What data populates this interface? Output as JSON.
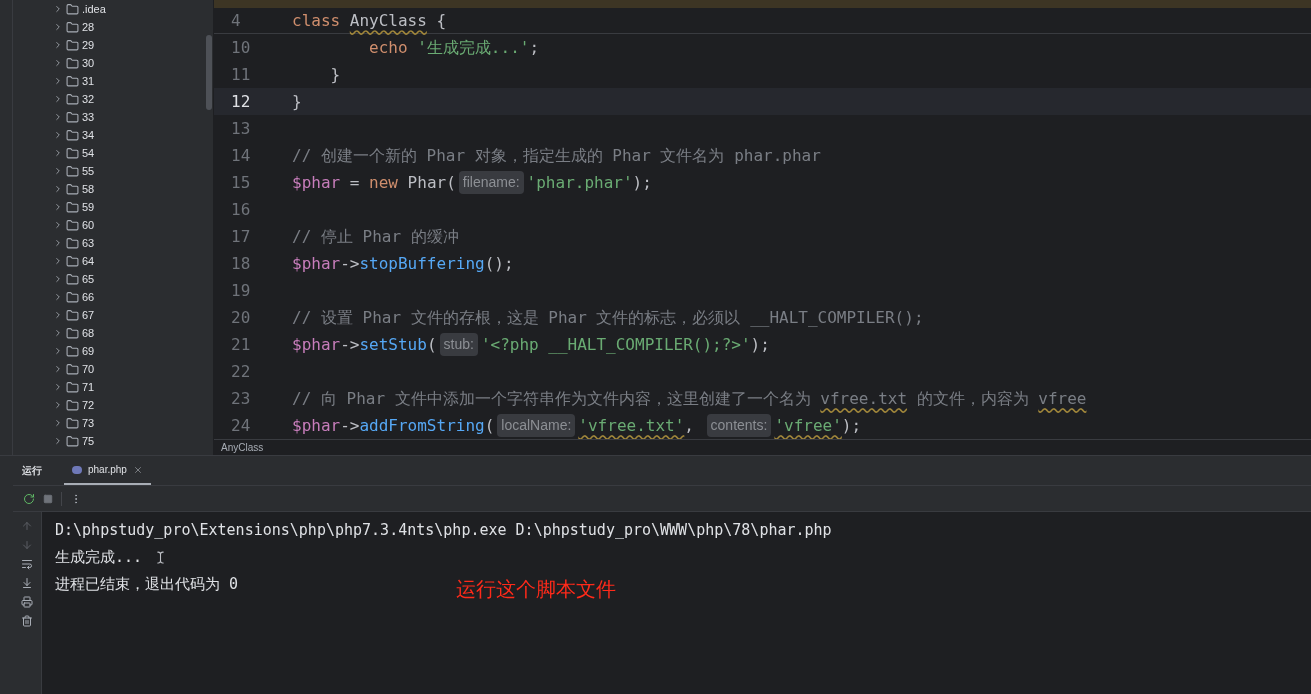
{
  "project_tree": {
    "items": [
      {
        "label": ".idea",
        "expanded": false
      },
      {
        "label": "28",
        "expanded": false
      },
      {
        "label": "29",
        "expanded": false
      },
      {
        "label": "30",
        "expanded": false
      },
      {
        "label": "31",
        "expanded": false
      },
      {
        "label": "32",
        "expanded": false
      },
      {
        "label": "33",
        "expanded": false
      },
      {
        "label": "34",
        "expanded": false
      },
      {
        "label": "54",
        "expanded": false
      },
      {
        "label": "55",
        "expanded": false
      },
      {
        "label": "58",
        "expanded": false
      },
      {
        "label": "59",
        "expanded": false
      },
      {
        "label": "60",
        "expanded": false
      },
      {
        "label": "63",
        "expanded": false
      },
      {
        "label": "64",
        "expanded": false
      },
      {
        "label": "65",
        "expanded": false
      },
      {
        "label": "66",
        "expanded": false
      },
      {
        "label": "67",
        "expanded": false
      },
      {
        "label": "68",
        "expanded": false
      },
      {
        "label": "69",
        "expanded": false
      },
      {
        "label": "70",
        "expanded": false
      },
      {
        "label": "71",
        "expanded": false
      },
      {
        "label": "72",
        "expanded": false
      },
      {
        "label": "73",
        "expanded": false
      },
      {
        "label": "75",
        "expanded": false
      }
    ]
  },
  "editor": {
    "sticky_line": {
      "number": "4",
      "tokens": [
        {
          "kind": "kw",
          "text": "class "
        },
        {
          "kind": "plain",
          "text": "AnyClass",
          "warn": true
        },
        {
          "kind": "plain",
          "text": " {"
        }
      ]
    },
    "lines": [
      {
        "number": "10",
        "current": false,
        "tokens": [
          {
            "kind": "kw",
            "text": "        echo"
          },
          {
            "kind": "str",
            "text": " '生成完成...'"
          },
          {
            "kind": "plain",
            "text": ";"
          }
        ]
      },
      {
        "number": "11",
        "current": false,
        "tokens": [
          {
            "kind": "plain",
            "text": "    }"
          }
        ]
      },
      {
        "number": "12",
        "current": true,
        "tokens": [
          {
            "kind": "plain",
            "text": "}"
          }
        ]
      },
      {
        "number": "13",
        "current": false
      },
      {
        "number": "14",
        "current": false,
        "tokens": [
          {
            "kind": "cm",
            "text": "// 创建一个新的 Phar 对象，指定生成的 Phar 文件名为 phar.phar"
          }
        ]
      },
      {
        "number": "15",
        "current": false,
        "tokens": [
          {
            "kind": "var",
            "text": "$phar"
          },
          {
            "kind": "plain",
            "text": " = "
          },
          {
            "kind": "kw",
            "text": "new"
          },
          {
            "kind": "plain",
            "text": " Phar("
          },
          {
            "kind": "hint",
            "text": "filename:"
          },
          {
            "kind": "str",
            "text": "'phar.phar'"
          },
          {
            "kind": "plain",
            "text": ");"
          }
        ]
      },
      {
        "number": "16",
        "current": false
      },
      {
        "number": "17",
        "current": false,
        "tokens": [
          {
            "kind": "cm",
            "text": "// 停止 Phar 的缓冲"
          }
        ]
      },
      {
        "number": "18",
        "current": false,
        "tokens": [
          {
            "kind": "var",
            "text": "$phar"
          },
          {
            "kind": "plain",
            "text": "->"
          },
          {
            "kind": "fn",
            "text": "stopBuffering"
          },
          {
            "kind": "plain",
            "text": "();"
          }
        ]
      },
      {
        "number": "19",
        "current": false
      },
      {
        "number": "20",
        "current": false,
        "tokens": [
          {
            "kind": "cm",
            "text": "// 设置 Phar 文件的存根，这是 Phar 文件的标志，必须以 __HALT_COMPILER();"
          }
        ]
      },
      {
        "number": "21",
        "current": false,
        "tokens": [
          {
            "kind": "var",
            "text": "$phar"
          },
          {
            "kind": "plain",
            "text": "->"
          },
          {
            "kind": "fn",
            "text": "setStub"
          },
          {
            "kind": "plain",
            "text": "("
          },
          {
            "kind": "hint",
            "text": "stub:"
          },
          {
            "kind": "str",
            "text": "'<?php __HALT_COMPILER();?>'"
          },
          {
            "kind": "plain",
            "text": ");"
          }
        ]
      },
      {
        "number": "22",
        "current": false
      },
      {
        "number": "23",
        "current": false,
        "tokens": [
          {
            "kind": "cm",
            "text": "// 向 Phar 文件中添加一个字符串作为文件内容，这里创建了一个名为 "
          },
          {
            "kind": "cm",
            "text": "vfree.txt",
            "warn": true
          },
          {
            "kind": "cm",
            "text": " 的文件，内容为 "
          },
          {
            "kind": "cm",
            "text": "vfree",
            "warn": true
          }
        ]
      },
      {
        "number": "24",
        "current": false,
        "tokens": [
          {
            "kind": "var",
            "text": "$phar"
          },
          {
            "kind": "plain",
            "text": "->"
          },
          {
            "kind": "fn",
            "text": "addFromString"
          },
          {
            "kind": "plain",
            "text": "("
          },
          {
            "kind": "hint",
            "text": "localName:"
          },
          {
            "kind": "str",
            "text": "'vfree.txt'",
            "warn": true
          },
          {
            "kind": "plain",
            "text": ", "
          },
          {
            "kind": "hint",
            "text": "contents:"
          },
          {
            "kind": "str",
            "text": "'vfree'",
            "warn": true
          },
          {
            "kind": "plain",
            "text": ");"
          }
        ]
      }
    ],
    "breadcrumb": "AnyClass"
  },
  "run_panel": {
    "title": "运行",
    "tabs": [
      {
        "label": "phar.php",
        "selected": true
      }
    ],
    "console": [
      "D:\\phpstudy_pro\\Extensions\\php\\php7.3.4nts\\php.exe D:\\phpstudy_pro\\WWW\\php\\78\\phar.php",
      "生成完成...",
      "进程已结束，退出代码为 0"
    ],
    "annotation": "运行这个脚本文件"
  }
}
